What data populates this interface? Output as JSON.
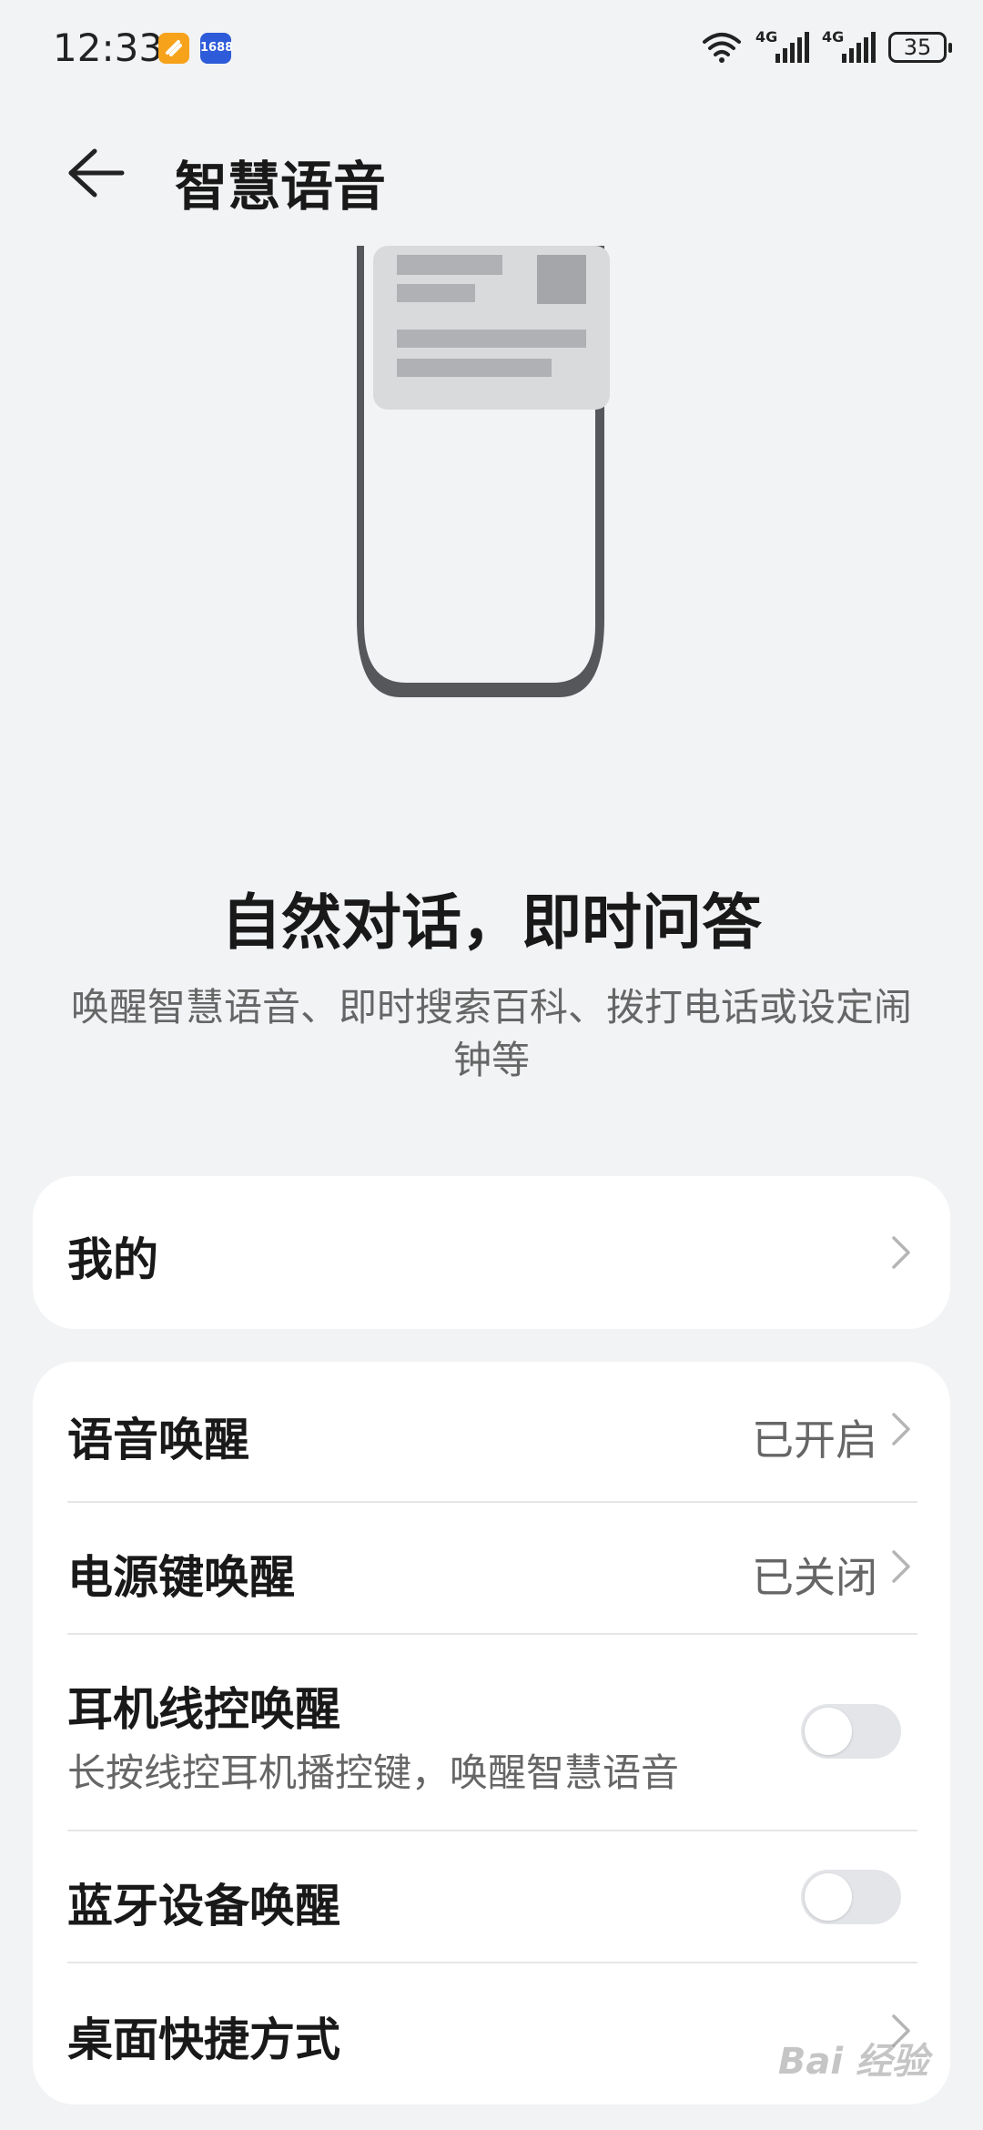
{
  "status_bar": {
    "time": "12:33",
    "app1": "",
    "app2": "1688",
    "signal1": "4G",
    "signal2": "4G",
    "battery": "35"
  },
  "header": {
    "title": "智慧语音"
  },
  "hero": {
    "title": "自然对话，即时问答",
    "description": "唤醒智慧语音、即时搜索百科、拨打电话或设定闹钟等"
  },
  "mine": {
    "label": "我的"
  },
  "settings": [
    {
      "label": "语音唤醒",
      "value": "已开启",
      "type": "link"
    },
    {
      "label": "电源键唤醒",
      "value": "已关闭",
      "type": "link"
    },
    {
      "label": "耳机线控唤醒",
      "sub": "长按线控耳机播控键，唤醒智慧语音",
      "type": "toggle",
      "on": false
    },
    {
      "label": "蓝牙设备唤醒",
      "type": "toggle",
      "on": false
    },
    {
      "label": "桌面快捷方式",
      "type": "link"
    }
  ],
  "watermark": "Bai 经验",
  "colors": {
    "background": "#f1f3f5",
    "card": "#ffffff",
    "toggle_off": "#e3e5e8"
  }
}
